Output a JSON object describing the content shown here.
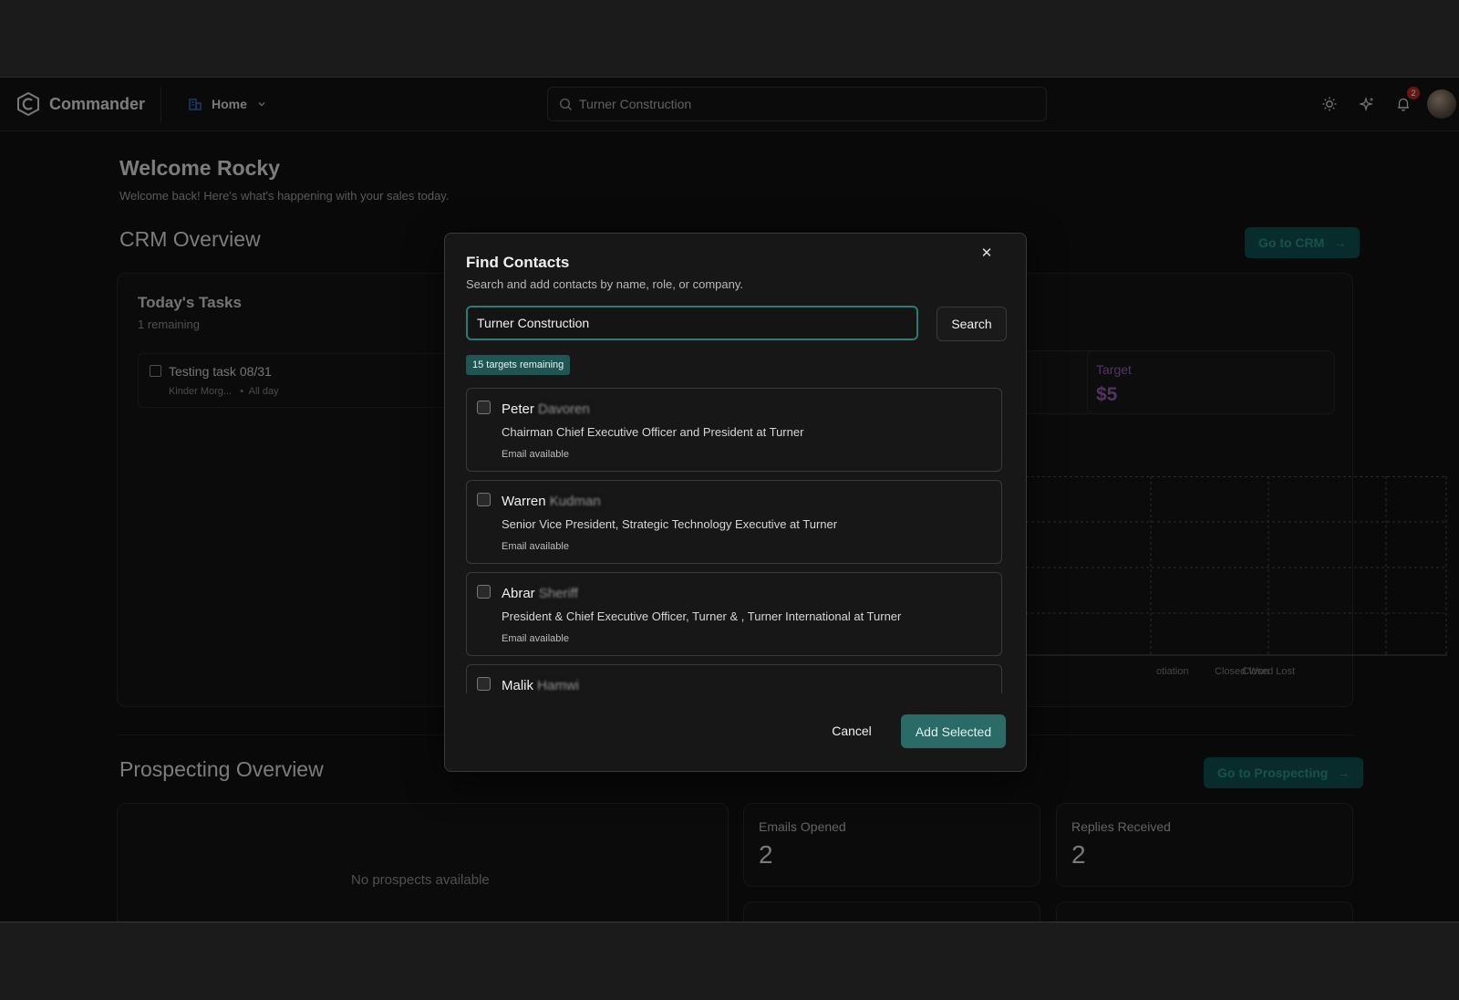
{
  "header": {
    "brand": "Commander",
    "nav_label": "Home",
    "search_value": "Turner Construction",
    "notification_count": "2"
  },
  "welcome": {
    "title": "Welcome Rocky",
    "subtitle": "Welcome back! Here's what's happening with your sales today."
  },
  "crm": {
    "title": "CRM Overview",
    "go_button": "Go to CRM",
    "tasks": {
      "title": "Today's Tasks",
      "remaining": "1 remaining",
      "items": [
        {
          "name": "Testing task 08/31",
          "company": "Kinder Morg...",
          "when": "All day"
        }
      ]
    },
    "target": {
      "label": "Target",
      "value": "$5"
    },
    "pipeline_labels": [
      "otiation",
      "Closed Won",
      "Closed Lost"
    ]
  },
  "prospecting": {
    "title": "Prospecting Overview",
    "go_button": "Go to Prospecting",
    "empty_text": "No prospects available",
    "metrics": [
      {
        "label": "Emails Opened",
        "value": "2"
      },
      {
        "label": "Replies Received",
        "value": "2"
      }
    ]
  },
  "modal": {
    "title": "Find Contacts",
    "description": "Search and add contacts by name, role, or company.",
    "search_value": "Turner Construction",
    "search_button": "Search",
    "targets_remaining": "15 targets remaining",
    "results": [
      {
        "first": "Peter",
        "last": " Davoren",
        "role": "Chairman Chief Executive Officer and President at Turner",
        "email": "Email available"
      },
      {
        "first": "Warren",
        "last": " Kudman",
        "role": "Senior Vice President, Strategic Technology Executive at Turner",
        "email": "Email available"
      },
      {
        "first": "Abrar",
        "last": " Sheriff",
        "role": "President & Chief Executive Officer, Turner & , Turner International at Turner",
        "email": "Email available"
      },
      {
        "first": "Malik",
        "last": " Hamwi",
        "role": "",
        "email": ""
      }
    ],
    "cancel_button": "Cancel",
    "add_button": "Add Selected"
  }
}
